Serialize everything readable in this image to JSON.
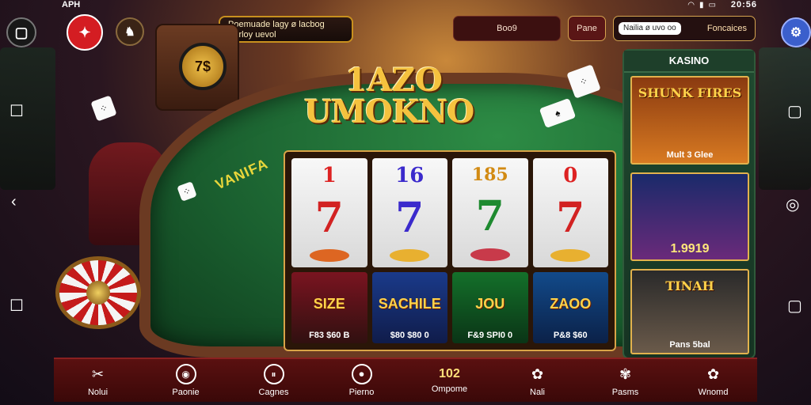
{
  "status": {
    "left": "APH",
    "time": "20:56"
  },
  "header": {
    "notice": "Poemuade lagy ø lacbog Barloy uevol",
    "pill1": "Boo9",
    "pill2": "Pane",
    "pill3_a": "Nailia ø uvo oo",
    "pill3_b": "Foncaices"
  },
  "top_buttons": {
    "b1": "▢",
    "b2": "✦",
    "b3": "♞",
    "b4": "⚙"
  },
  "table": {
    "logo_line1": "1AZO",
    "logo_line2": "UMOKNO",
    "felt_label": "VANIFA"
  },
  "clock": {
    "face": "7$"
  },
  "reels": [
    {
      "top": "1",
      "seven": "7",
      "color": "#d22222",
      "card_art": "SIZE",
      "card_value": "F83 $60 B"
    },
    {
      "top": "16",
      "seven": "7",
      "color": "#3b2acc",
      "card_art": "SACHILE",
      "card_value": "$80 $80 0"
    },
    {
      "top": "185",
      "seven": "7",
      "color": "#1e8a30",
      "card_art": "JOU",
      "card_value": "F&9 SPI0 0"
    },
    {
      "top": "0",
      "seven": "7",
      "color": "#d22222",
      "card_art": "ZAOO",
      "card_value": "P&8 $60"
    }
  ],
  "sidebar": {
    "title": "KASINO",
    "promos": [
      {
        "art": "SHUNK FIRES",
        "label": "Mult 3 Glee"
      },
      {
        "art": "",
        "label": "1.9919"
      },
      {
        "art": "TINAH",
        "label": "Pans 5bal"
      }
    ]
  },
  "bottom_nav": [
    {
      "icon": "✂",
      "label": "Nolui"
    },
    {
      "icon": "◉",
      "label": "Paonie"
    },
    {
      "icon": "⏸",
      "label": "Cagnes"
    },
    {
      "icon": "⏺",
      "label": "Pierno"
    },
    {
      "number": "102",
      "label": "Ompome"
    },
    {
      "icon": "✿",
      "label": "Nali"
    },
    {
      "icon": "✾",
      "label": "Pasms"
    },
    {
      "icon": "✿",
      "label": "Wnomd"
    }
  ],
  "colors": {
    "felt": "#1a5f2f",
    "rail": "#6b3a22",
    "accent_gold": "#f5c23e",
    "nav_bg": "#5a1010"
  }
}
